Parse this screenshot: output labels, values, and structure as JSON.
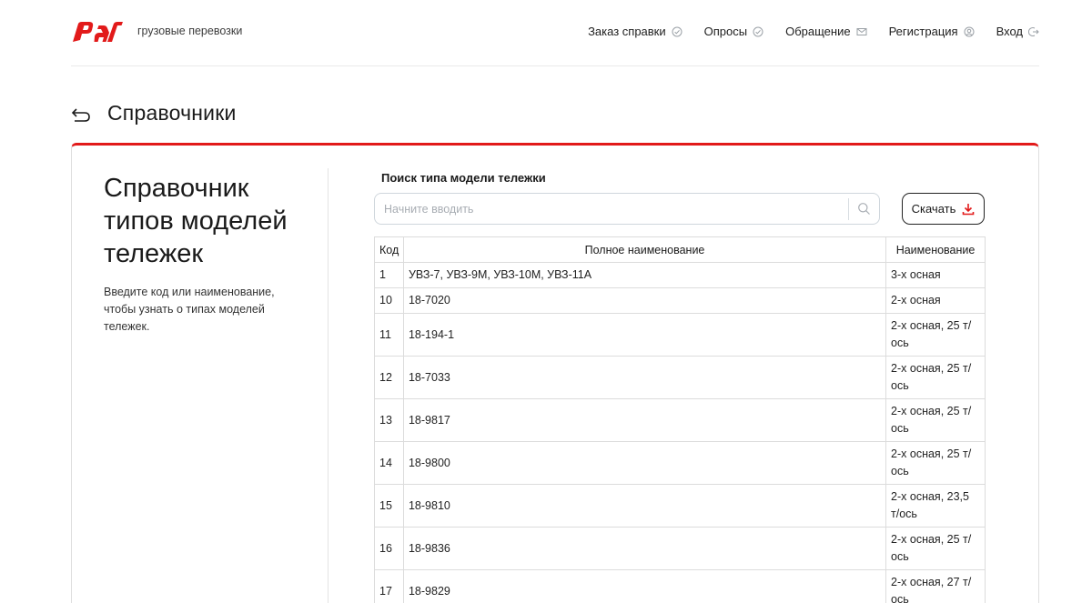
{
  "brand": {
    "logo_text": "РЖД",
    "subtitle": "грузовые перевозки",
    "logo_color": "#e21a1a"
  },
  "nav": [
    {
      "label": "Заказ справки",
      "icon": "check-circle-icon"
    },
    {
      "label": "Опросы",
      "icon": "check-circle-icon"
    },
    {
      "label": "Обращение",
      "icon": "envelope-icon"
    },
    {
      "label": "Регистрация",
      "icon": "user-circle-icon"
    },
    {
      "label": "Вход",
      "icon": "logout-icon"
    }
  ],
  "page": {
    "title": "Справочники",
    "back_icon": "back-arrow-icon"
  },
  "card": {
    "accent_color": "#e21a1a",
    "heading": "Справочник типов моделей тележек",
    "description": "Введите код или наименование, чтобы узнать о типах моделей тележек."
  },
  "search": {
    "label": "Поиск типа модели тележки",
    "placeholder": "Начните вводить",
    "value": "",
    "icon": "search-icon"
  },
  "download": {
    "label": "Скачать",
    "icon": "download-icon"
  },
  "table": {
    "headers": [
      "Код",
      "Полное наименование",
      "Наименование"
    ],
    "rows": [
      {
        "code": "1",
        "full": "УВЗ-7, УВЗ-9М, УВЗ-10М, УВЗ-11А",
        "name_lines": [
          "3-х осная"
        ]
      },
      {
        "code": "10",
        "full": "18-7020",
        "name_lines": [
          "2-х осная"
        ]
      },
      {
        "code": "11",
        "full": "18-194-1",
        "name_lines": [
          "2-х осная, 25 т/",
          "ось"
        ]
      },
      {
        "code": "12",
        "full": "18-7033",
        "name_lines": [
          "2-х осная, 25 т/",
          "ось"
        ]
      },
      {
        "code": "13",
        "full": "18-9817",
        "name_lines": [
          "2-х осная, 25 т/",
          "ось"
        ]
      },
      {
        "code": "14",
        "full": "18-9800",
        "name_lines": [
          "2-х осная, 25 т/",
          "ось"
        ]
      },
      {
        "code": "15",
        "full": "18-9810",
        "name_lines": [
          "2-х осная, 23,5",
          "т/ось"
        ]
      },
      {
        "code": "16",
        "full": "18-9836",
        "name_lines": [
          "2-х осная, 25 т/",
          "ось"
        ]
      },
      {
        "code": "17",
        "full": "18-9829",
        "name_lines": [
          "2-х осная, 27 т/",
          "ось"
        ]
      }
    ]
  }
}
